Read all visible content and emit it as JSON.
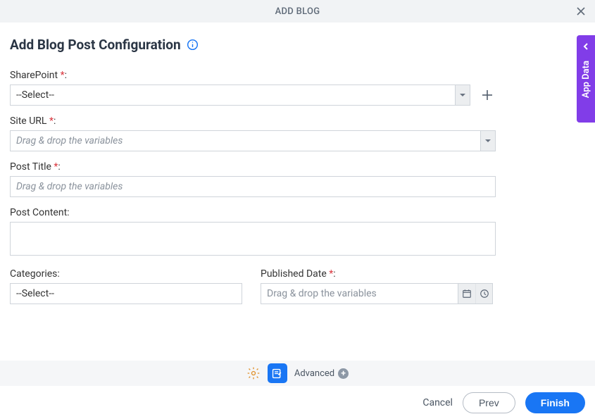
{
  "window": {
    "title": "ADD BLOG"
  },
  "page": {
    "heading": "Add Blog Post Configuration"
  },
  "labels": {
    "sharepoint": "SharePoint",
    "site_url": "Site URL",
    "post_title": "Post Title",
    "post_content": "Post Content:",
    "categories": "Categories:",
    "published_date": "Published Date"
  },
  "fields": {
    "sharepoint": {
      "value": "--Select--"
    },
    "site_url": {
      "placeholder": "Drag & drop the variables"
    },
    "post_title": {
      "placeholder": "Drag & drop the variables"
    },
    "post_content": {
      "value": ""
    },
    "categories": {
      "value": "--Select--"
    },
    "published_date": {
      "placeholder": "Drag & drop the variables"
    }
  },
  "toolbar": {
    "advanced_label": "Advanced"
  },
  "footer": {
    "cancel": "Cancel",
    "prev": "Prev",
    "finish": "Finish"
  },
  "side_tab": {
    "label": "App Data"
  },
  "colors": {
    "primary": "#1976f4",
    "side": "#813de8"
  }
}
